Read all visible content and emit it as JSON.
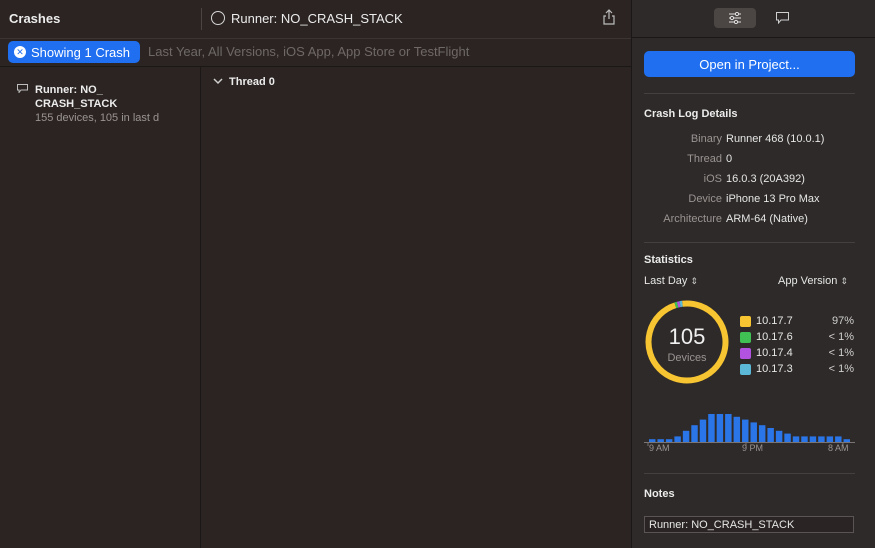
{
  "titlebar": {
    "section_title": "Crashes",
    "crash_title": "Runner: NO_CRASH_STACK"
  },
  "filter": {
    "pill_label": "Showing 1 Crash",
    "description": "Last Year, All Versions, iOS App, App Store or TestFlight"
  },
  "crash_list": {
    "items": [
      {
        "title": "Runner: NO_ CRASH_STACK",
        "subtitle": "155 devices, 105 in last d"
      }
    ]
  },
  "thread": {
    "label": "Thread 0"
  },
  "inspector": {
    "open_button": "Open in Project...",
    "details_title": "Crash Log Details",
    "details": [
      {
        "key": "Binary",
        "value": "Runner 468 (10.0.1)"
      },
      {
        "key": "Thread",
        "value": "0"
      },
      {
        "key": "iOS",
        "value": "16.0.3 (20A392)"
      },
      {
        "key": "Device",
        "value": "iPhone 13 Pro Max"
      },
      {
        "key": "Architecture",
        "value": "ARM-64 (Native)"
      }
    ],
    "statistics_title": "Statistics",
    "time_selector": "Last Day",
    "group_selector": "App Version",
    "devices_count": "105",
    "devices_label": "Devices",
    "notes_title": "Notes",
    "notes_value": "Runner: NO_CRASH_STACK"
  },
  "colors": {
    "accent": "#1f6ff0",
    "yellow": "#f7c531",
    "green": "#3fc153",
    "purple": "#b152e0",
    "teal": "#5bb8d6"
  },
  "chart_data": {
    "type": "pie",
    "center_value": 105,
    "center_label": "Devices",
    "categories": [
      "10.17.7",
      "10.17.6",
      "10.17.4",
      "10.17.3"
    ],
    "labels": [
      "97%",
      "< 1%",
      "< 1%",
      "< 1%"
    ],
    "values": [
      97,
      1,
      1,
      1
    ],
    "colors": [
      "#f7c531",
      "#3fc153",
      "#b152e0",
      "#5bb8d6"
    ],
    "histogram": {
      "type": "bar",
      "x_ticks": [
        "9 AM",
        "9 PM",
        "8 AM"
      ],
      "values": [
        1,
        1,
        1,
        2,
        4,
        6,
        8,
        10,
        10,
        10,
        9,
        8,
        7,
        6,
        5,
        4,
        3,
        2,
        2,
        2,
        2,
        2,
        2,
        1
      ]
    }
  }
}
